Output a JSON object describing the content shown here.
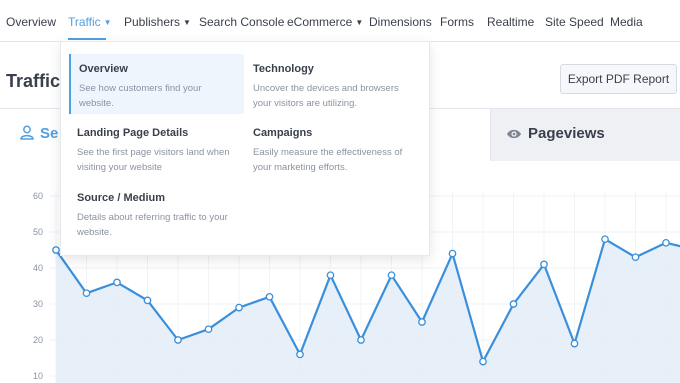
{
  "nav": {
    "items": [
      {
        "label": "Overview",
        "has_chevron": false
      },
      {
        "label": "Traffic",
        "has_chevron": true,
        "active": true
      },
      {
        "label": "Publishers",
        "has_chevron": true
      },
      {
        "label": "Search Console",
        "has_chevron": false
      },
      {
        "label": "eCommerce",
        "has_chevron": true
      },
      {
        "label": "Dimensions",
        "has_chevron": false
      },
      {
        "label": "Forms",
        "has_chevron": false
      },
      {
        "label": "Realtime",
        "has_chevron": false
      },
      {
        "label": "Site Speed",
        "has_chevron": false
      },
      {
        "label": "Media",
        "has_chevron": false
      }
    ]
  },
  "page": {
    "title": "Traffic",
    "export_label": "Export PDF Report"
  },
  "tabs": {
    "sessions_label": "Se",
    "pageviews_label": "Pageviews",
    "sessions_icon": "user-icon",
    "pageviews_icon": "eye-icon"
  },
  "dropdown": {
    "items": [
      {
        "title": "Overview",
        "desc_line1": "See how customers find your",
        "desc_line2": "website.",
        "highlight": true
      },
      {
        "title": "Technology",
        "desc_line1": "Uncover the devices and browsers",
        "desc_line2": "your visitors are utilizing.",
        "highlight": false
      },
      {
        "title": "Landing Page Details",
        "desc_line1": "See the first page visitors land when",
        "desc_line2": "visiting your website",
        "highlight": false
      },
      {
        "title": "Campaigns",
        "desc_line1": "Easily measure the effectiveness of",
        "desc_line2": "your marketing efforts.",
        "highlight": false
      },
      {
        "title": "Source / Medium",
        "desc_line1": "Details about referring traffic to your",
        "desc_line2": "website.",
        "highlight": false
      }
    ]
  },
  "colors": {
    "accent": "#509fe2",
    "line": "#3a8fdb",
    "fill": "#e4edf8",
    "text": "#393f4c",
    "muted": "#8a93a2"
  },
  "chart_data": {
    "type": "area",
    "y_ticks": [
      "60",
      "50",
      "40",
      "30",
      "20",
      "10"
    ],
    "ylim": [
      10,
      60
    ],
    "values": [
      45,
      33,
      36,
      31,
      20,
      23,
      29,
      32,
      16,
      38,
      20,
      38,
      25,
      44,
      14,
      30,
      41,
      19,
      48,
      43,
      47,
      45
    ],
    "grid": true
  }
}
